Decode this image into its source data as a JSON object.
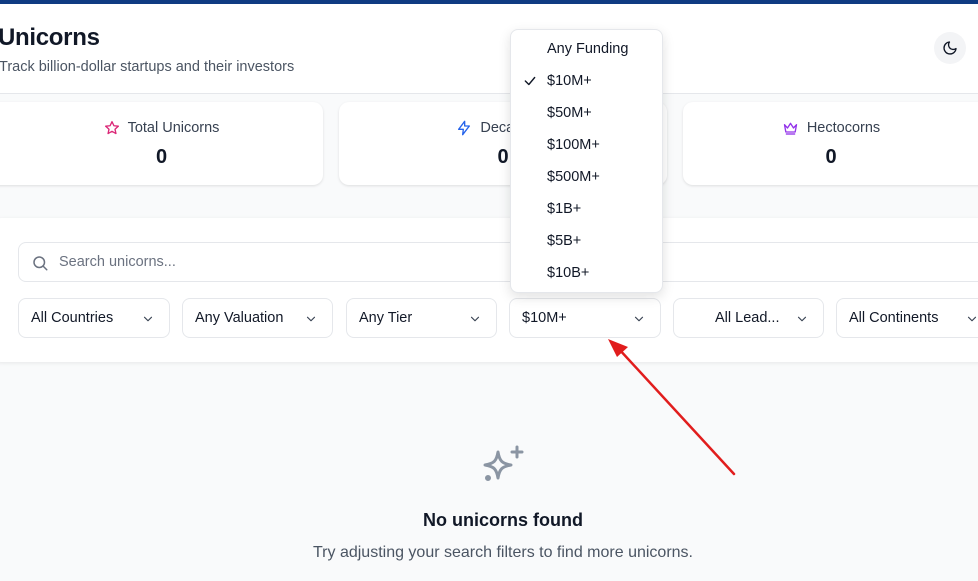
{
  "header": {
    "title": "Unicorns",
    "subtitle": "Track billion-dollar startups and their investors",
    "theme_toggle_icon": "moon-icon"
  },
  "stats": [
    {
      "label": "Total Unicorns",
      "value": "0",
      "icon": "star-icon",
      "color": "#db2777"
    },
    {
      "label": "Decacorns",
      "value": "0",
      "icon": "lightning-icon",
      "color": "#2563eb"
    },
    {
      "label": "Hectocorns",
      "value": "0",
      "icon": "crown-icon",
      "color": "#9333ea"
    }
  ],
  "search": {
    "placeholder": "Search unicorns..."
  },
  "filters": {
    "country": "All Countries",
    "valuation": "Any Valuation",
    "tier": "Any Tier",
    "funding": "$10M+",
    "lead": "All Lead...",
    "continent": "All Continents"
  },
  "funding_dropdown": {
    "options": [
      "Any Funding",
      "$10M+",
      "$50M+",
      "$100M+",
      "$500M+",
      "$1B+",
      "$5B+",
      "$10B+"
    ],
    "selected": "$10M+"
  },
  "empty_state": {
    "icon": "sparkles-icon",
    "title": "No unicorns found",
    "text": "Try adjusting your search filters to find more unicorns."
  },
  "colors": {
    "topbar": "#0f3b82",
    "annotation_arrow": "#e11d1d"
  }
}
